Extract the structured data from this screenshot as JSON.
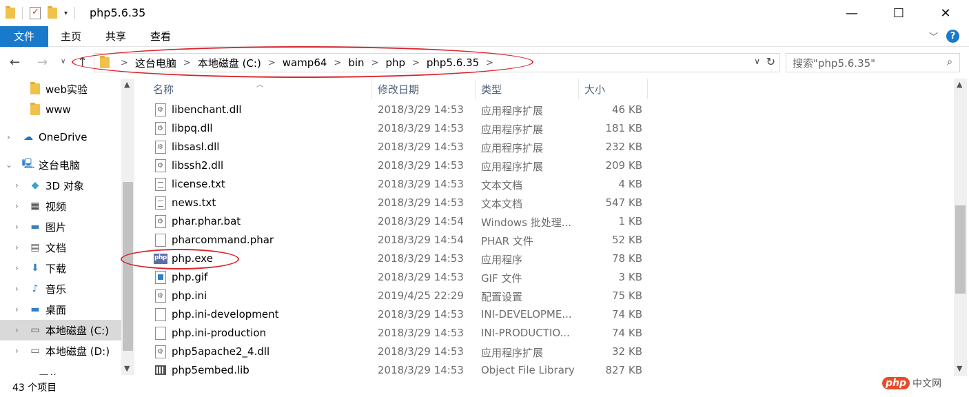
{
  "window": {
    "title": "php5.6.35",
    "minimize_glyph": "—",
    "maximize_glyph": "☐",
    "close_glyph": "✕"
  },
  "ribbon": {
    "tabs": [
      "文件",
      "主页",
      "共享",
      "查看"
    ],
    "file_tab_color": "#1979ca",
    "help_glyph": "?"
  },
  "address": {
    "breadcrumbs": [
      "这台电脑",
      "本地磁盘 (C:)",
      "wamp64",
      "bin",
      "php",
      "php5.6.35"
    ],
    "search_placeholder": "搜索\"php5.6.35\""
  },
  "nav_tree": [
    {
      "label": "web实验",
      "icon": "folder-icon",
      "selected": false
    },
    {
      "label": "www",
      "icon": "folder-icon",
      "selected": false
    },
    {
      "label": "OneDrive",
      "icon": "cloud-icon",
      "selected": false
    },
    {
      "label": "这台电脑",
      "icon": "computer-icon",
      "selected": false
    },
    {
      "label": "3D 对象",
      "icon": "cube-icon",
      "selected": false
    },
    {
      "label": "视频",
      "icon": "video-icon",
      "selected": false
    },
    {
      "label": "图片",
      "icon": "picture-icon",
      "selected": false
    },
    {
      "label": "文档",
      "icon": "document-icon",
      "selected": false
    },
    {
      "label": "下载",
      "icon": "download-icon",
      "selected": false
    },
    {
      "label": "音乐",
      "icon": "music-icon",
      "selected": false
    },
    {
      "label": "桌面",
      "icon": "desktop-icon",
      "selected": false
    },
    {
      "label": "本地磁盘 (C:)",
      "icon": "drive-c-icon",
      "selected": true
    },
    {
      "label": "本地磁盘 (D:)",
      "icon": "drive-d-icon",
      "selected": false
    },
    {
      "label": "网络",
      "icon": "network-icon",
      "selected": false
    }
  ],
  "columns": {
    "name": "名称",
    "date": "修改日期",
    "type": "类型",
    "size": "大小"
  },
  "files": [
    {
      "name": "libenchant.dll",
      "date": "2018/3/29 14:53",
      "type": "应用程序扩展",
      "size": "46 KB",
      "icon": "dll-file-icon"
    },
    {
      "name": "libpq.dll",
      "date": "2018/3/29 14:53",
      "type": "应用程序扩展",
      "size": "181 KB",
      "icon": "dll-file-icon"
    },
    {
      "name": "libsasl.dll",
      "date": "2018/3/29 14:53",
      "type": "应用程序扩展",
      "size": "232 KB",
      "icon": "dll-file-icon"
    },
    {
      "name": "libssh2.dll",
      "date": "2018/3/29 14:53",
      "type": "应用程序扩展",
      "size": "209 KB",
      "icon": "dll-file-icon"
    },
    {
      "name": "license.txt",
      "date": "2018/3/29 14:53",
      "type": "文本文档",
      "size": "4 KB",
      "icon": "text-file-icon"
    },
    {
      "name": "news.txt",
      "date": "2018/3/29 14:53",
      "type": "文本文档",
      "size": "547 KB",
      "icon": "text-file-icon"
    },
    {
      "name": "phar.phar.bat",
      "date": "2018/3/29 14:54",
      "type": "Windows 批处理...",
      "size": "1 KB",
      "icon": "bat-file-icon"
    },
    {
      "name": "pharcommand.phar",
      "date": "2018/3/29 14:54",
      "type": "PHAR 文件",
      "size": "52 KB",
      "icon": "blank-file-icon"
    },
    {
      "name": "php.exe",
      "date": "2018/3/29 14:53",
      "type": "应用程序",
      "size": "78 KB",
      "icon": "php-exe-icon"
    },
    {
      "name": "php.gif",
      "date": "2018/3/29 14:53",
      "type": "GIF 文件",
      "size": "3 KB",
      "icon": "gif-file-icon"
    },
    {
      "name": "php.ini",
      "date": "2019/4/25 22:29",
      "type": "配置设置",
      "size": "75 KB",
      "icon": "ini-file-icon"
    },
    {
      "name": "php.ini-development",
      "date": "2018/3/29 14:53",
      "type": "INI-DEVELOPME...",
      "size": "74 KB",
      "icon": "blank-file-icon"
    },
    {
      "name": "php.ini-production",
      "date": "2018/3/29 14:53",
      "type": "INI-PRODUCTIO...",
      "size": "74 KB",
      "icon": "blank-file-icon"
    },
    {
      "name": "php5apache2_4.dll",
      "date": "2018/3/29 14:53",
      "type": "应用程序扩展",
      "size": "32 KB",
      "icon": "dll-file-icon"
    },
    {
      "name": "php5embed.lib",
      "date": "2018/3/29 14:53",
      "type": "Object File Library",
      "size": "827 KB",
      "icon": "lib-file-icon"
    }
  ],
  "status": {
    "count": "43 个项目",
    "watermark_logo": "php",
    "watermark_text": "中文网"
  },
  "annotation_color": "#d9252c"
}
